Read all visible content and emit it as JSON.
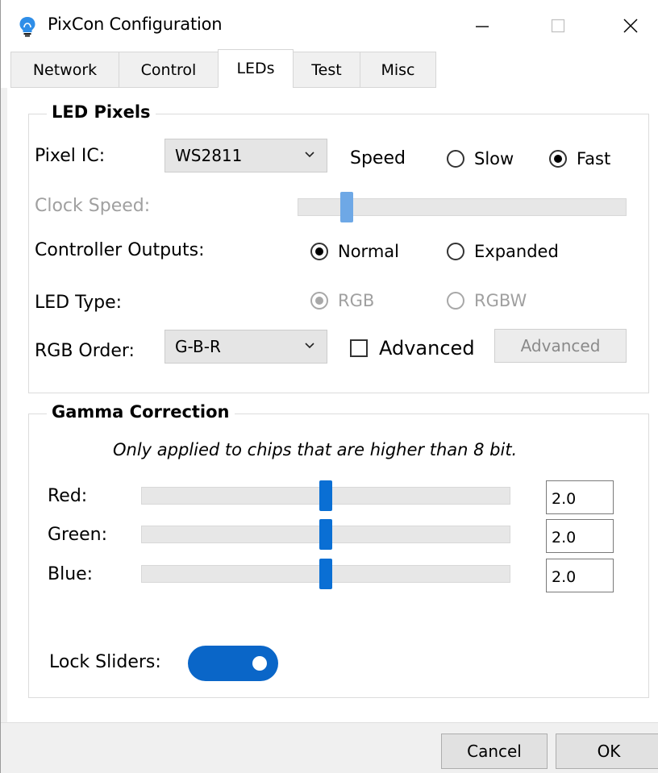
{
  "window": {
    "title": "PixCon Configuration",
    "icon": "lightbulb-icon"
  },
  "tabs": [
    {
      "label": "Network",
      "active": false
    },
    {
      "label": "Control",
      "active": false
    },
    {
      "label": "LEDs",
      "active": true
    },
    {
      "label": "Test",
      "active": false
    },
    {
      "label": "Misc",
      "active": false
    }
  ],
  "led_pixels": {
    "title": "LED Pixels",
    "pixel_ic_label": "Pixel IC:",
    "pixel_ic_value": "WS2811",
    "speed_label": "Speed",
    "speed_slow": "Slow",
    "speed_fast": "Fast",
    "speed_selected": "Fast",
    "clock_speed_label": "Clock Speed:",
    "clock_speed_fraction": 0.1,
    "controller_outputs_label": "Controller Outputs:",
    "outputs_normal": "Normal",
    "outputs_expanded": "Expanded",
    "outputs_selected": "Normal",
    "led_type_label": "LED Type:",
    "led_type_rgb": "RGB",
    "led_type_rgbw": "RGBW",
    "led_type_selected": "RGB",
    "rgb_order_label": "RGB Order:",
    "rgb_order_value": "G-B-R",
    "advanced_checkbox_label": "Advanced",
    "advanced_checked": false,
    "advanced_button_label": "Advanced"
  },
  "gamma": {
    "title": "Gamma Correction",
    "note": "Only applied to chips that are higher than 8 bit.",
    "red_label": "Red:",
    "red_value": "2.0",
    "green_label": "Green:",
    "green_value": "2.0",
    "blue_label": "Blue:",
    "blue_value": "2.0",
    "slider_fraction": 0.5,
    "lock_sliders_label": "Lock Sliders:",
    "lock_sliders_on": true
  },
  "footer": {
    "cancel_label": "Cancel",
    "ok_label": "OK"
  },
  "colors": {
    "accent": "#0a6fd4",
    "toggle_on": "#0a66c8",
    "app_icon": "#2f8ee8"
  }
}
